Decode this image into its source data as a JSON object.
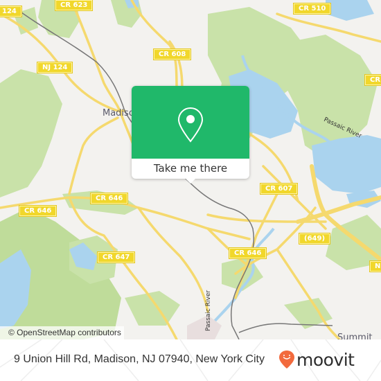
{
  "map": {
    "road_shields": [
      {
        "id": "cr623",
        "label": "CR 623"
      },
      {
        "id": "cr510",
        "label": "CR 510"
      },
      {
        "id": "nj124-nw",
        "label": "124"
      },
      {
        "id": "cr608",
        "label": "CR 608"
      },
      {
        "id": "nj124",
        "label": "NJ 124"
      },
      {
        "id": "cr-east",
        "label": "CR"
      },
      {
        "id": "cr607",
        "label": "CR 607"
      },
      {
        "id": "cr646-west",
        "label": "CR 646"
      },
      {
        "id": "cr646-mid",
        "label": "CR 646"
      },
      {
        "id": "cr649",
        "label": "(649)"
      },
      {
        "id": "nj-east",
        "label": "N"
      },
      {
        "id": "cr647",
        "label": "CR 647"
      },
      {
        "id": "cr646-east",
        "label": "CR 646"
      }
    ],
    "places": {
      "madison": "Madison",
      "summit": "Summit"
    },
    "water_labels": {
      "passaic_river_ne": "Passaic River",
      "passaic_river_s": "Passaic River"
    },
    "attribution": "© OpenStreetMap contributors"
  },
  "popup": {
    "icon": "map-pin-icon",
    "cta_label": "Take me there",
    "color": "#20b86a"
  },
  "footer": {
    "address": "9 Union Hill Rd, Madison, NJ 07940, New York City",
    "brand_name": "moovit",
    "brand_color": "#f26a3d"
  }
}
